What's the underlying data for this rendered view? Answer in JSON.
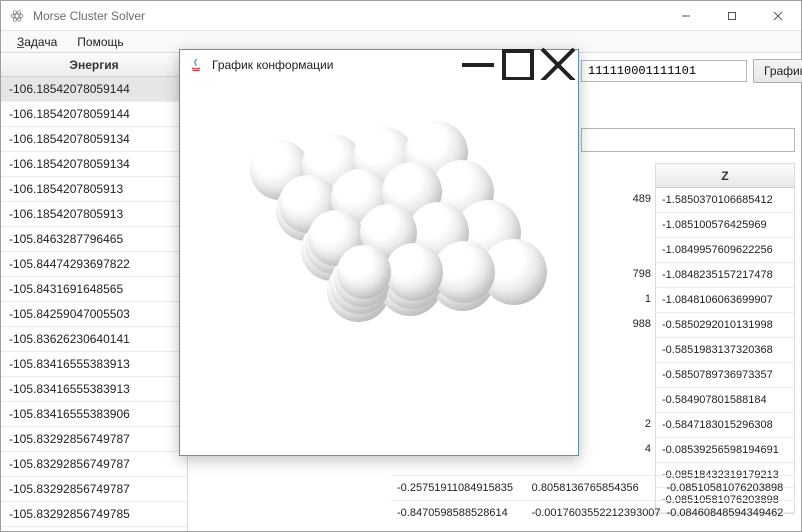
{
  "main_window": {
    "title": "Morse Cluster Solver",
    "menu": {
      "task": "Задача",
      "help": "Помощь"
    },
    "left": {
      "header": "Энергия",
      "rows": [
        "-106.18542078059144",
        "-106.18542078059144",
        "-106.18542078059134",
        "-106.18542078059134",
        "-106.1854207805913",
        "-106.1854207805913",
        "-105.8463287796465",
        "-105.84474293697822",
        "-105.8431691648565",
        "-105.84259047005503",
        "-105.83626230640141",
        "-105.83416555383913",
        "-105.83416555383913",
        "-105.83416555383906",
        "-105.83292856749787",
        "-105.83292856749787",
        "-105.83292856749787",
        "-105.83292856749785"
      ],
      "selected_index": 0
    },
    "top": {
      "field_value": "111110001111101",
      "button": "График"
    },
    "z_column": {
      "header": "Z",
      "cells": [
        "-1.5850370106685412",
        "-1.085100576425969",
        "-1.0849957609622256",
        "-1.0848235157217478",
        "-1.0848106063699907",
        "-0.5850292010131998",
        "-0.5851983137320368",
        "-0.5850789736973357",
        "-0.584907801588184",
        "-0.5847183015296308",
        "-0.08539256598194691",
        "-0.08518432319179213",
        "-0.08510581076203898"
      ]
    },
    "y_fragments": [
      "489",
      "",
      "",
      "798",
      "1",
      "988",
      "",
      "",
      "",
      "2",
      "4",
      "",
      ""
    ],
    "bottom_rows": [
      {
        "x": "-0.25751911084915835",
        "y": "0.8058136765854356",
        "z": "-0.08510581076203898"
      },
      {
        "x": "-0.8470598588528614",
        "y": "-0.0017603552212393007",
        "z": "-0.08460848594349462"
      }
    ]
  },
  "popup": {
    "title": "График конформации"
  }
}
